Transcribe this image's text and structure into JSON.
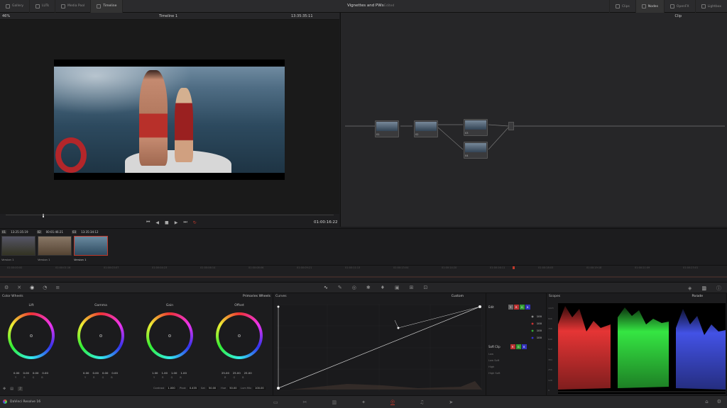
{
  "topbar": {
    "tabs": [
      "Gallery",
      "LUTs",
      "Media Pool",
      "Timeline"
    ],
    "project_title": "Vignettes and PWs",
    "project_status": "Edited",
    "right_tabs": [
      "Clips",
      "Nodes",
      "OpenFX",
      "Lightbox"
    ]
  },
  "viewer": {
    "zoom": "46%",
    "timeline_name": "Timeline 1",
    "source_tc": "13:35:35:11",
    "record_tc": "01:00:16:22"
  },
  "nodes": {
    "mode": "Clip",
    "node_labels": [
      "01",
      "02",
      "03",
      "04"
    ]
  },
  "clips": [
    {
      "num": "01",
      "tc": "13:25:35:19",
      "label": "Version 1"
    },
    {
      "num": "02",
      "tc": "00:01:46:21",
      "label": "Version 1"
    },
    {
      "num": "03",
      "tc": "13:35:34:12",
      "label": "Version 1"
    }
  ],
  "timeline_ticks": [
    "01:00:00:00",
    "01:00:01:16",
    "01:00:03:07",
    "01:00:04:23",
    "01:00:06:14",
    "01:00:08:06",
    "01:00:09:21",
    "01:00:11:13",
    "01:00:13:04",
    "01:00:14:20",
    "01:00:16:11",
    "01:00:18:03",
    "01:00:19:18",
    "01:00:21:09",
    "01:00:23:01"
  ],
  "color_wheels": {
    "title": "Color Wheels",
    "mode": "Primaries Wheels",
    "wheels": [
      {
        "name": "Lift",
        "vals": [
          "0.00",
          "0.00",
          "0.00",
          "0.00"
        ]
      },
      {
        "name": "Gamma",
        "vals": [
          "0.00",
          "0.00",
          "0.00",
          "0.00"
        ]
      },
      {
        "name": "Gain",
        "vals": [
          "1.00",
          "1.00",
          "1.00",
          "1.00"
        ]
      },
      {
        "name": "Offset",
        "vals": [
          "25.00",
          "25.00",
          "25.00"
        ]
      }
    ],
    "channels": [
      "Y",
      "R",
      "G",
      "B"
    ],
    "adjust": [
      {
        "k": "Contrast",
        "v": "1.000"
      },
      {
        "k": "Pivot",
        "v": "0.435"
      },
      {
        "k": "Sat",
        "v": "50.00"
      },
      {
        "k": "Hue",
        "v": "50.00"
      },
      {
        "k": "Lum Mix",
        "v": "100.00"
      }
    ],
    "page": "2"
  },
  "curves": {
    "title": "Curves",
    "mode": "Custom",
    "edit_label": "Edit",
    "edit_vals": [
      "100",
      "100",
      "100",
      "100"
    ],
    "softclip_label": "Soft Clip",
    "softclip_rows": [
      "Low",
      "Low Soft",
      "High",
      "High Soft"
    ]
  },
  "scopes": {
    "title": "Scopes",
    "mode": "Parade",
    "scale": [
      "1023",
      "896",
      "768",
      "640",
      "512",
      "384",
      "256",
      "128",
      "0"
    ]
  },
  "app": {
    "name": "DaVinci Resolve 16"
  },
  "colors": {
    "accent_red": "#c0392b",
    "bg": "#1c1c1e"
  }
}
